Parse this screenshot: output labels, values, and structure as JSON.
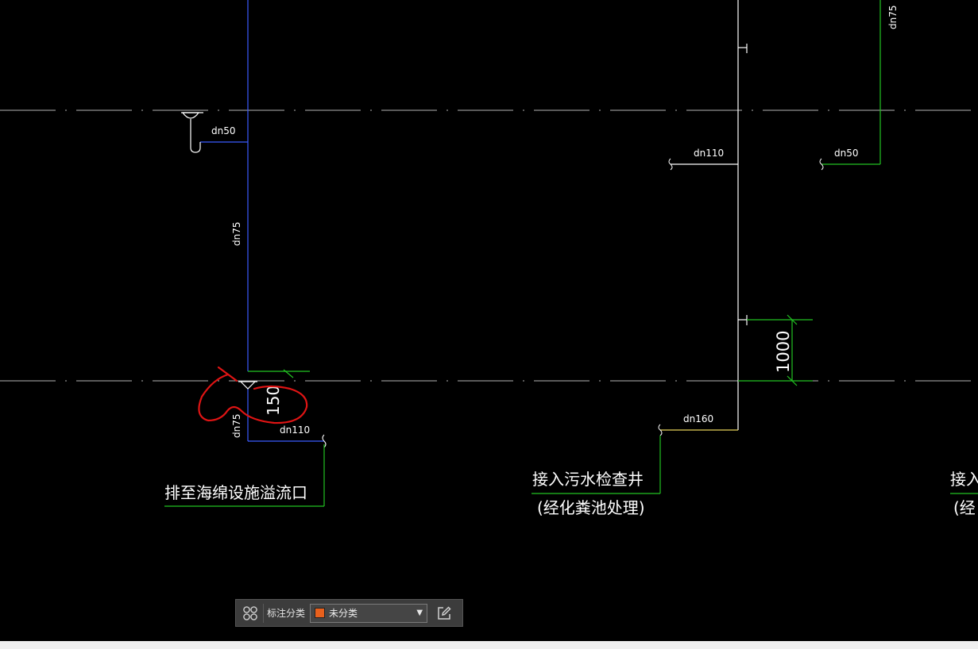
{
  "drawing": {
    "pipe_labels": {
      "top_right_dn75": "dn75",
      "left_branch_dn50": "dn50",
      "left_riser_dn75": "dn75",
      "mid_branch_dn110": "dn110",
      "right_branch_dn50": "dn50",
      "left_lower_dn75": "dn75",
      "left_outlet_dn110": "dn110",
      "mid_outlet_dn160": "dn160"
    },
    "dimensions": {
      "right_offset": "1000",
      "left_offset": "150"
    },
    "notes": {
      "left_outlet": "排至海绵设施溢流口",
      "mid_outlet": "接入污水检查井",
      "mid_outlet_sub": "(经化粪池处理)",
      "right_outlet_partial": "接入",
      "right_outlet_sub_partial": "(经"
    },
    "colors": {
      "background": "#000000",
      "pipe_blue": "#3b5bff",
      "pipe_white": "#ffffff",
      "pipe_green": "#22c322",
      "pipe_yellow": "#e6d25a",
      "axis_line": "#b4b4b4",
      "markup_red": "#e01414"
    }
  },
  "toolbar": {
    "grid_icon": "grid-icon",
    "label": "标注分类",
    "selected_category": "未分类",
    "swatch_color": "#e8601c",
    "dropdown_icon": "chevron-down-icon",
    "edit_icon": "edit-icon"
  }
}
